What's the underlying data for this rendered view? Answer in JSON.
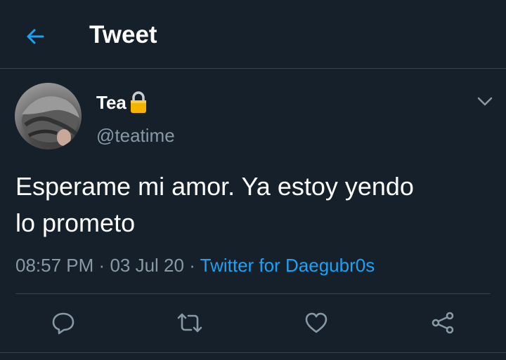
{
  "header": {
    "title": "Tweet",
    "back_icon": "arrow-left-icon"
  },
  "tweet": {
    "display_name": "Tea",
    "locked_icon": "lock-icon",
    "handle": "@teatime",
    "text_line1": "Esperame mi amor. Ya estoy yendo",
    "text_line2": "lo prometo",
    "time": "08:57 PM",
    "separator": "·",
    "date": "03 Jul 20",
    "source": "Twitter for Daegubr0s"
  },
  "actions": [
    {
      "icon": "reply-icon"
    },
    {
      "icon": "retweet-icon"
    },
    {
      "icon": "heart-icon"
    },
    {
      "icon": "share-icon"
    }
  ],
  "colors": {
    "background": "#15202b",
    "accent": "#1da1f2",
    "secondary_text": "#8899a6",
    "divider": "#38444d",
    "lock": "#f5b400"
  }
}
